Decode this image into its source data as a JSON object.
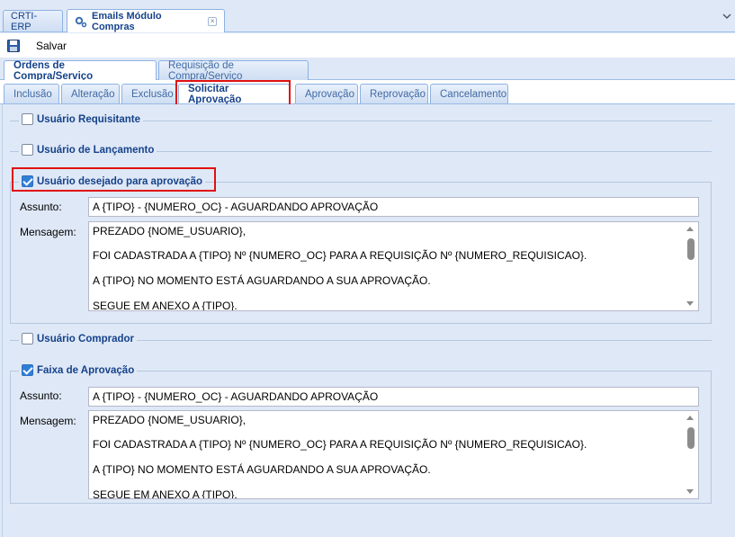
{
  "app_tabs": [
    {
      "label": "CRTI-ERP",
      "active": false
    },
    {
      "label": "Emails Módulo Compras",
      "active": true,
      "icon": "gear-icon",
      "closable": true
    }
  ],
  "toolbar": {
    "save_label": "Salvar",
    "save_icon": "floppy-disk-icon"
  },
  "primary_tabs": [
    {
      "label": "Ordens de Compra/Serviço",
      "active": true
    },
    {
      "label": "Requisição de Compra/Serviço",
      "active": false
    }
  ],
  "secondary_tabs": [
    {
      "label": "Inclusão",
      "active": false
    },
    {
      "label": "Alteração",
      "active": false
    },
    {
      "label": "Exclusão",
      "active": false
    },
    {
      "label": "Solicitar Aprovação",
      "active": true
    },
    {
      "label": "Aprovação",
      "active": false
    },
    {
      "label": "Reprovação",
      "active": false
    },
    {
      "label": "Cancelamento",
      "active": false
    }
  ],
  "sections": {
    "usuario_requisitante": {
      "label": "Usuário Requisitante",
      "checked": false
    },
    "usuario_lancamento": {
      "label": "Usuário de Lançamento",
      "checked": false
    },
    "usuario_desejado": {
      "label": "Usuário desejado para aprovação",
      "checked": true,
      "assunto_label": "Assunto:",
      "assunto_value": "A {TIPO} - {NUMERO_OC} - AGUARDANDO APROVAÇÃO",
      "mensagem_label": "Mensagem:",
      "mensagem_lines": [
        "PREZADO {NOME_USUARIO},",
        "FOI CADASTRADA A {TIPO} Nº {NUMERO_OC} PARA A REQUISIÇÃO Nº {NUMERO_REQUISICAO}.",
        "A {TIPO} NO MOMENTO ESTÁ AGUARDANDO A SUA APROVAÇÃO.",
        "SEGUE EM ANEXO A {TIPO}."
      ]
    },
    "usuario_comprador": {
      "label": "Usuário Comprador",
      "checked": false
    },
    "faixa_aprovacao": {
      "label": "Faixa de Aprovação",
      "checked": true,
      "assunto_label": "Assunto:",
      "assunto_value": "A {TIPO} - {NUMERO_OC} - AGUARDANDO APROVAÇÃO",
      "mensagem_label": "Mensagem:",
      "mensagem_lines": [
        "PREZADO {NOME_USUARIO},",
        "FOI CADASTRADA A {TIPO} Nº {NUMERO_OC} PARA A REQUISIÇÃO Nº {NUMERO_REQUISICAO}.",
        "A {TIPO} NO MOMENTO ESTÁ AGUARDANDO A SUA APROVAÇÃO.",
        "SEGUE EM ANEXO A {TIPO}."
      ]
    }
  },
  "colors": {
    "highlight": "#e01010",
    "tab_text": "#15428b",
    "panel_bg": "#dfe8f6"
  }
}
